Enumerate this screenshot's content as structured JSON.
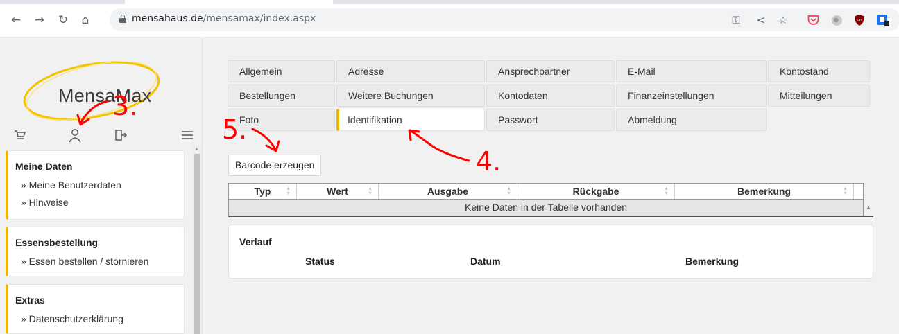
{
  "browser": {
    "domain": "mensahaus.de",
    "path": "/mensamax/index.aspx"
  },
  "icons": {
    "back": "back-arrow-icon",
    "forward": "forward-arrow-icon",
    "reload": "reload-icon",
    "home": "home-icon",
    "lock": "lock-icon",
    "key": "key-icon",
    "share": "share-icon",
    "star": "star-icon",
    "pocket": "pocket-icon",
    "globe": "globe-icon",
    "ublock": "ublock-icon",
    "extension": "extension-icon",
    "cart": "cart-icon",
    "user": "user-icon",
    "logout": "logout-icon",
    "hamburger": "hamburger-icon"
  },
  "logo": {
    "text": "MensaMax"
  },
  "sidebar": {
    "groups": [
      {
        "title": "Meine Daten",
        "items": [
          "» Meine Benutzerdaten",
          "» Hinweise"
        ]
      },
      {
        "title": "Essensbestellung",
        "items": [
          "» Essen bestellen / stornieren"
        ]
      },
      {
        "title": "Extras",
        "items": [
          "» Datenschutzerklärung"
        ]
      }
    ]
  },
  "tabs": {
    "row1": [
      "Allgemein",
      "Adresse",
      "Ansprechpartner",
      "E-Mail",
      "Kontostand"
    ],
    "row2": [
      "Bestellungen",
      "Weitere Buchungen",
      "Kontodaten",
      "Finanzeinstellungen",
      "Mitteilungen"
    ],
    "row3": [
      "Foto",
      "Identifikation",
      "Passwort",
      "Abmeldung"
    ],
    "active": "Identifikation"
  },
  "barcode_button": "Barcode erzeugen",
  "table": {
    "columns": [
      "Typ",
      "Wert",
      "Ausgabe",
      "Rückgabe",
      "Bemerkung"
    ],
    "empty_text": "Keine Daten in der Tabelle vorhanden"
  },
  "verlauf": {
    "title": "Verlauf",
    "columns": [
      "Status",
      "Datum",
      "Bemerkung"
    ]
  },
  "annotations": {
    "step3": "3.",
    "step4": "4.",
    "step5": "5."
  },
  "colors": {
    "accent": "#f0b400",
    "annotation": "#ff0000",
    "background": "#f1f1f1"
  }
}
